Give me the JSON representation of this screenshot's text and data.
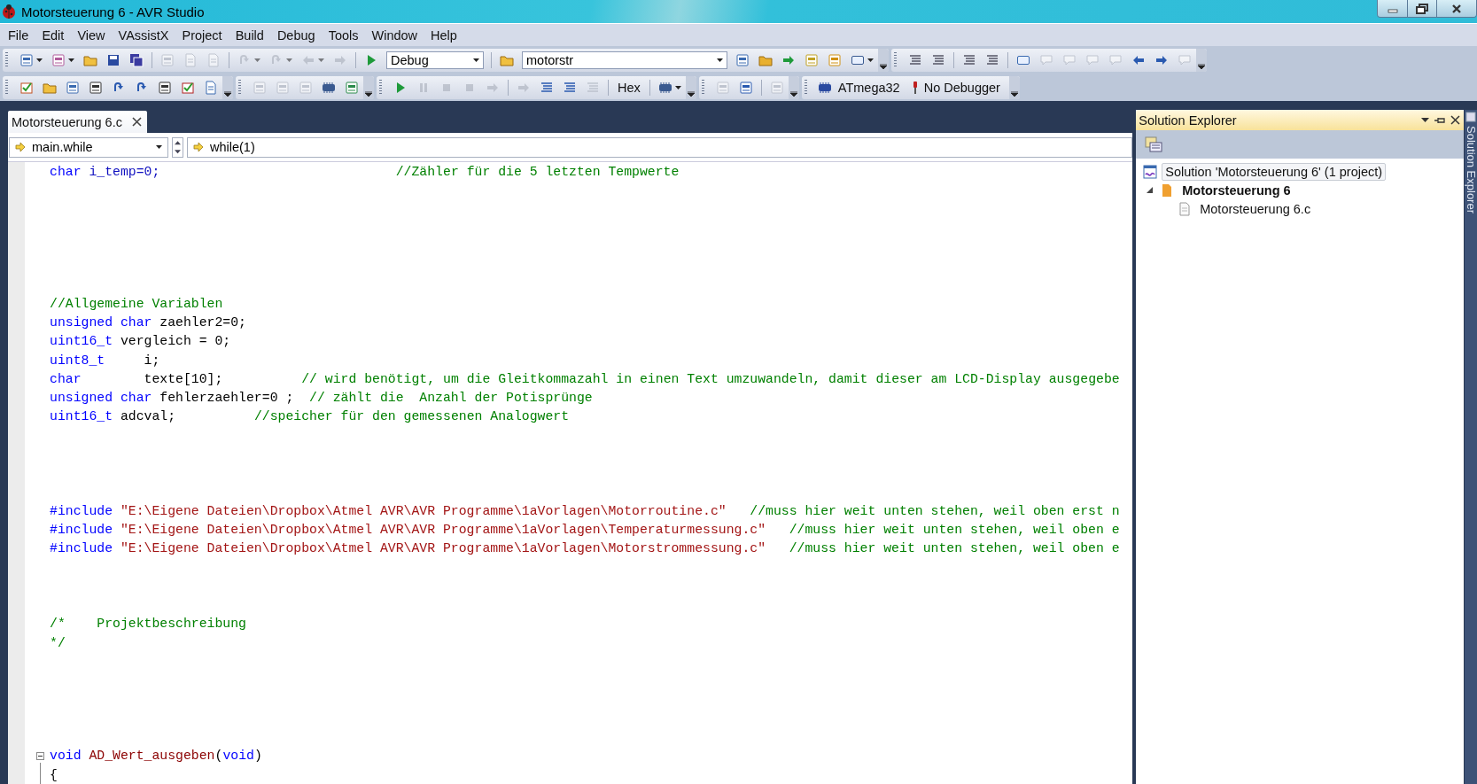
{
  "window": {
    "title": "Motorsteuerung 6 - AVR Studio"
  },
  "menu": [
    {
      "label": "File"
    },
    {
      "label": "Edit"
    },
    {
      "label": "View"
    },
    {
      "label": "VAssistX"
    },
    {
      "label": "Project"
    },
    {
      "label": "Build"
    },
    {
      "label": "Debug"
    },
    {
      "label": "Tools"
    },
    {
      "label": "Window"
    },
    {
      "label": "Help"
    }
  ],
  "toolbars": [
    {
      "groups": [
        {
          "items": [
            {
              "kind": "split",
              "disabled": false
            },
            {
              "kind": "split",
              "disabled": false
            },
            {
              "kind": "button",
              "disabled": false
            },
            {
              "kind": "button",
              "disabled": false
            },
            {
              "kind": "button",
              "disabled": false
            },
            {
              "kind": "separator"
            },
            {
              "kind": "button",
              "disabled": true
            },
            {
              "kind": "button",
              "disabled": true
            },
            {
              "kind": "button",
              "disabled": true
            },
            {
              "kind": "separator"
            },
            {
              "kind": "split",
              "disabled": true
            },
            {
              "kind": "split",
              "disabled": true
            },
            {
              "kind": "split",
              "disabled": true
            },
            {
              "kind": "button",
              "disabled": true
            },
            {
              "kind": "separator"
            },
            {
              "kind": "button",
              "disabled": false
            },
            {
              "kind": "combo",
              "value": "Debug"
            },
            {
              "kind": "separator"
            },
            {
              "kind": "button",
              "disabled": false
            },
            {
              "kind": "combo",
              "value": "motorstr"
            },
            {
              "kind": "button",
              "disabled": false
            },
            {
              "kind": "button",
              "disabled": false
            },
            {
              "kind": "button",
              "disabled": false
            },
            {
              "kind": "button",
              "disabled": false
            },
            {
              "kind": "button",
              "disabled": false
            },
            {
              "kind": "split",
              "disabled": false
            }
          ]
        },
        {
          "items": [
            {
              "kind": "button",
              "disabled": false
            },
            {
              "kind": "button",
              "disabled": false
            },
            {
              "kind": "separator"
            },
            {
              "kind": "button",
              "disabled": false
            },
            {
              "kind": "button",
              "disabled": false
            },
            {
              "kind": "separator"
            },
            {
              "kind": "button",
              "disabled": false
            },
            {
              "kind": "button",
              "disabled": true
            },
            {
              "kind": "button",
              "disabled": true
            },
            {
              "kind": "button",
              "disabled": true
            },
            {
              "kind": "button",
              "disabled": true
            },
            {
              "kind": "button",
              "disabled": false
            },
            {
              "kind": "button",
              "disabled": false
            },
            {
              "kind": "button",
              "disabled": true
            }
          ]
        }
      ]
    },
    {
      "groups": [
        {
          "items": [
            {
              "kind": "button",
              "disabled": false
            },
            {
              "kind": "button",
              "disabled": false
            },
            {
              "kind": "button",
              "disabled": false
            },
            {
              "kind": "button",
              "disabled": false
            },
            {
              "kind": "button",
              "disabled": false
            },
            {
              "kind": "button",
              "disabled": false
            },
            {
              "kind": "button",
              "disabled": false
            },
            {
              "kind": "button",
              "disabled": false
            },
            {
              "kind": "button",
              "disabled": false
            }
          ]
        },
        {
          "items": [
            {
              "kind": "button",
              "disabled": true
            },
            {
              "kind": "button",
              "disabled": true
            },
            {
              "kind": "button",
              "disabled": true
            },
            {
              "kind": "button",
              "disabled": false
            },
            {
              "kind": "button",
              "disabled": false
            }
          ]
        },
        {
          "items": [
            {
              "kind": "button",
              "disabled": false
            },
            {
              "kind": "button",
              "disabled": true
            },
            {
              "kind": "button",
              "disabled": true
            },
            {
              "kind": "button",
              "disabled": true
            },
            {
              "kind": "button",
              "disabled": true
            },
            {
              "kind": "separator"
            },
            {
              "kind": "button",
              "disabled": true
            },
            {
              "kind": "button",
              "disabled": false
            },
            {
              "kind": "button",
              "disabled": false
            },
            {
              "kind": "button",
              "disabled": true
            },
            {
              "kind": "separator"
            },
            {
              "kind": "text-button",
              "label": "Hex"
            },
            {
              "kind": "separator"
            },
            {
              "kind": "split",
              "disabled": false
            }
          ]
        },
        {
          "items": [
            {
              "kind": "button",
              "disabled": true
            },
            {
              "kind": "button",
              "disabled": false
            },
            {
              "kind": "separator"
            },
            {
              "kind": "button",
              "disabled": true
            }
          ]
        },
        {
          "items": [
            {
              "kind": "icon-label",
              "label": "ATmega32"
            },
            {
              "kind": "icon-label",
              "label": "No Debugger"
            }
          ]
        }
      ]
    }
  ],
  "document_tab": {
    "label": "Motorsteuerung 6.c",
    "selected": true
  },
  "navigation_bar": {
    "scope": "main.while",
    "member": "while(1)"
  },
  "editor": {
    "lines": [
      {
        "tokens": [
          {
            "kind": "keyword",
            "text": "char"
          },
          {
            "kind": "variable",
            "text": " i_temp=0;                              "
          },
          {
            "kind": "comment",
            "text": "//Zähler für die 5 letzten Tempwerte"
          }
        ]
      },
      {
        "kind": "blank"
      },
      {
        "kind": "blank"
      },
      {
        "kind": "blank"
      },
      {
        "kind": "blank"
      },
      {
        "kind": "blank"
      },
      {
        "kind": "blank"
      },
      {
        "tokens": [
          {
            "kind": "comment",
            "text": "//Allgemeine Variablen"
          }
        ]
      },
      {
        "tokens": [
          {
            "kind": "keyword",
            "text": "unsigned char"
          },
          {
            "kind": "plain",
            "text": " zaehler2=0;"
          }
        ]
      },
      {
        "tokens": [
          {
            "kind": "keyword",
            "text": "uint16_t"
          },
          {
            "kind": "plain",
            "text": " vergleich = 0;"
          }
        ]
      },
      {
        "tokens": [
          {
            "kind": "keyword",
            "text": "uint8_t"
          },
          {
            "kind": "plain",
            "text": "     i;"
          }
        ]
      },
      {
        "tokens": [
          {
            "kind": "keyword",
            "text": "char"
          },
          {
            "kind": "plain",
            "text": "        texte[10];          "
          },
          {
            "kind": "comment",
            "text": "// wird benötigt, um die Gleitkommazahl in einen Text umzuwandeln, damit dieser am LCD-Display ausgegebe"
          }
        ]
      },
      {
        "tokens": [
          {
            "kind": "keyword",
            "text": "unsigned char"
          },
          {
            "kind": "plain",
            "text": " fehlerzaehler=0 ;  "
          },
          {
            "kind": "comment",
            "text": "// zählt die  Anzahl der Potisprünge"
          }
        ]
      },
      {
        "tokens": [
          {
            "kind": "keyword",
            "text": "uint16_t"
          },
          {
            "kind": "plain",
            "text": " adcval;          "
          },
          {
            "kind": "comment",
            "text": "//speicher für den gemessenen Analogwert"
          }
        ]
      },
      {
        "kind": "blank"
      },
      {
        "kind": "blank"
      },
      {
        "kind": "blank"
      },
      {
        "kind": "blank"
      },
      {
        "tokens": [
          {
            "kind": "preprocessor",
            "text": "#include "
          },
          {
            "kind": "string",
            "text": "\"E:\\Eigene Dateien\\Dropbox\\Atmel AVR\\AVR Programme\\1aVorlagen\\Motorroutine.c\"   "
          },
          {
            "kind": "comment",
            "text": "//muss hier weit unten stehen, weil oben erst n"
          }
        ]
      },
      {
        "tokens": [
          {
            "kind": "preprocessor",
            "text": "#include "
          },
          {
            "kind": "string",
            "text": "\"E:\\Eigene Dateien\\Dropbox\\Atmel AVR\\AVR Programme\\1aVorlagen\\Temperaturmessung.c\"   "
          },
          {
            "kind": "comment",
            "text": "//muss hier weit unten stehen, weil oben e"
          }
        ]
      },
      {
        "tokens": [
          {
            "kind": "preprocessor",
            "text": "#include "
          },
          {
            "kind": "string",
            "text": "\"E:\\Eigene Dateien\\Dropbox\\Atmel AVR\\AVR Programme\\1aVorlagen\\Motorstrommessung.c\"   "
          },
          {
            "kind": "comment",
            "text": "//muss hier weit unten stehen, weil oben e"
          }
        ]
      },
      {
        "kind": "blank"
      },
      {
        "kind": "blank"
      },
      {
        "kind": "blank"
      },
      {
        "tokens": [
          {
            "kind": "comment",
            "text": "/*    Projektbeschreibung"
          }
        ]
      },
      {
        "tokens": [
          {
            "kind": "comment",
            "text": "*/"
          }
        ]
      },
      {
        "kind": "blank"
      },
      {
        "kind": "blank"
      },
      {
        "kind": "blank"
      },
      {
        "kind": "blank"
      },
      {
        "kind": "blank"
      },
      {
        "fold": {
          "expanded": true
        },
        "tokens": [
          {
            "kind": "keyword",
            "text": "void "
          },
          {
            "kind": "function",
            "text": "AD_Wert_ausgeben"
          },
          {
            "kind": "plain",
            "text": "("
          },
          {
            "kind": "keyword",
            "text": "void"
          },
          {
            "kind": "plain",
            "text": ")"
          }
        ]
      },
      {
        "guide": true,
        "tokens": [
          {
            "kind": "plain",
            "text": "{"
          }
        ]
      }
    ]
  },
  "solution_explorer": {
    "title": "Solution Explorer",
    "side_tab": "Solution Explorer",
    "tree": [
      {
        "label": "Solution 'Motorsteuerung 6' (1 project)",
        "kind": "solution",
        "selected": true,
        "children": [
          {
            "label": "Motorsteuerung 6",
            "kind": "project",
            "selected": false,
            "expanded": true,
            "children": [
              {
                "label": "Motorsteuerung 6.c",
                "kind": "file",
                "selected": false
              }
            ]
          }
        ]
      }
    ]
  }
}
